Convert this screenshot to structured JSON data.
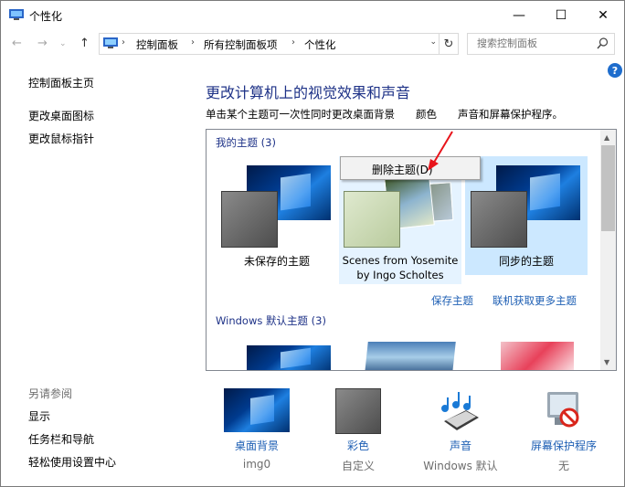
{
  "window": {
    "title": "个性化",
    "minimize_glyph": "—",
    "maximize_glyph": "☐",
    "close_glyph": "✕"
  },
  "address": {
    "crumbs": [
      "控制面板",
      "所有控制面板项",
      "个性化"
    ],
    "search_placeholder": "搜索控制面板"
  },
  "sidebar": {
    "home": "控制面板主页",
    "links": [
      "更改桌面图标",
      "更改鼠标指针"
    ],
    "see_also_header": "另请参阅",
    "see_also": [
      "显示",
      "任务栏和导航",
      "轻松使用设置中心"
    ]
  },
  "main": {
    "heading": "更改计算机上的视觉效果和声音",
    "description": "单击某个主题可一次性同时更改桌面背景　　颜色　　声音和屏幕保护程序。"
  },
  "themes": {
    "my_group_label": "我的主题 (3)",
    "my_themes": [
      {
        "name": "未保存的主题"
      },
      {
        "name": "Scenes from Yosemite\nby Ingo Scholtes"
      },
      {
        "name": "同步的主题"
      }
    ],
    "save_theme": "保存主题",
    "get_more_online": "联机获取更多主题",
    "windows_group_label": "Windows 默认主题 (3)"
  },
  "context_menu": {
    "delete_theme": "删除主题(D)"
  },
  "bottom": [
    {
      "label": "桌面背景",
      "value": "img0",
      "icon": "desktop-background-icon"
    },
    {
      "label": "彩色",
      "value": "自定义",
      "icon": "color-swatch-icon"
    },
    {
      "label": "声音",
      "value": "Windows 默认",
      "icon": "sound-icon"
    },
    {
      "label": "屏幕保护程序",
      "value": "无",
      "icon": "screensaver-icon"
    }
  ],
  "colors": {
    "accent_blue": "#1e6dcd",
    "heading_blue": "#1e3287",
    "link_blue": "#1e5fb4",
    "selection": "#cce8ff",
    "annotation_red": "#e8141b"
  }
}
